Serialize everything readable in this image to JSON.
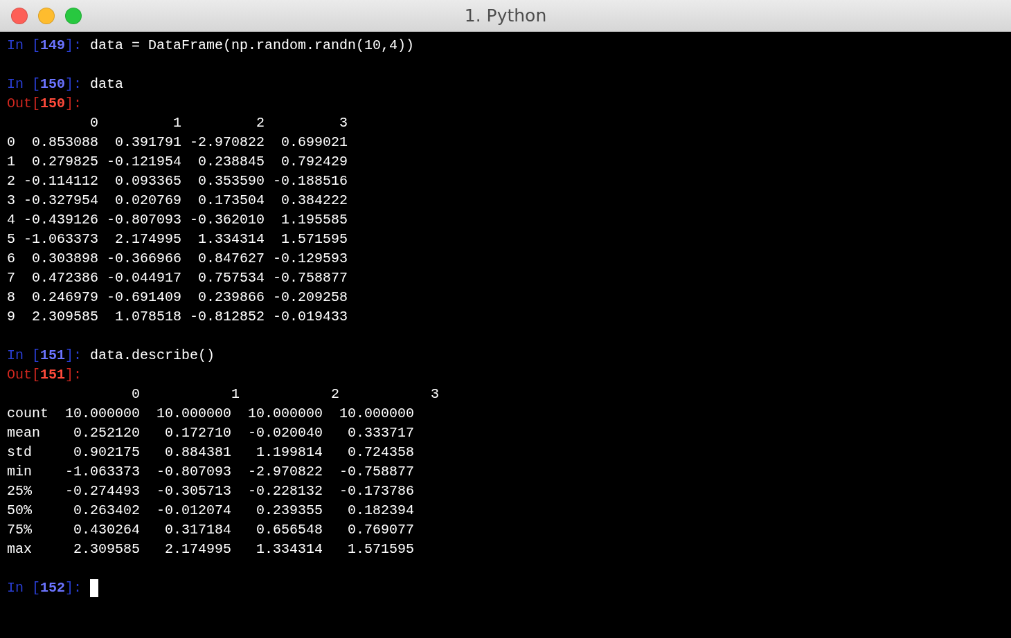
{
  "window": {
    "title": "1. Python"
  },
  "lines": [
    {
      "kind": "input",
      "prompt_open": "In [",
      "number": "149",
      "prompt_close": "]: ",
      "code": "data = DataFrame(np.random.randn(10,4))",
      "cursor": false
    },
    {
      "kind": "blank"
    },
    {
      "kind": "input",
      "prompt_open": "In [",
      "number": "150",
      "prompt_close": "]: ",
      "code": "data",
      "cursor": false
    },
    {
      "kind": "output",
      "prompt_open": "Out[",
      "number": "150",
      "prompt_close": "]:"
    },
    {
      "kind": "text",
      "text": "          0         1         2         3"
    },
    {
      "kind": "text",
      "text": "0  0.853088  0.391791 -2.970822  0.699021"
    },
    {
      "kind": "text",
      "text": "1  0.279825 -0.121954  0.238845  0.792429"
    },
    {
      "kind": "text",
      "text": "2 -0.114112  0.093365  0.353590 -0.188516"
    },
    {
      "kind": "text",
      "text": "3 -0.327954  0.020769  0.173504  0.384222"
    },
    {
      "kind": "text",
      "text": "4 -0.439126 -0.807093 -0.362010  1.195585"
    },
    {
      "kind": "text",
      "text": "5 -1.063373  2.174995  1.334314  1.571595"
    },
    {
      "kind": "text",
      "text": "6  0.303898 -0.366966  0.847627 -0.129593"
    },
    {
      "kind": "text",
      "text": "7  0.472386 -0.044917  0.757534 -0.758877"
    },
    {
      "kind": "text",
      "text": "8  0.246979 -0.691409  0.239866 -0.209258"
    },
    {
      "kind": "text",
      "text": "9  2.309585  1.078518 -0.812852 -0.019433"
    },
    {
      "kind": "blank"
    },
    {
      "kind": "input",
      "prompt_open": "In [",
      "number": "151",
      "prompt_close": "]: ",
      "code": "data.describe()",
      "cursor": false
    },
    {
      "kind": "output",
      "prompt_open": "Out[",
      "number": "151",
      "prompt_close": "]:"
    },
    {
      "kind": "text",
      "text": "               0           1           2           3"
    },
    {
      "kind": "text",
      "text": "count  10.000000  10.000000  10.000000  10.000000"
    },
    {
      "kind": "text",
      "text": "mean    0.252120   0.172710  -0.020040   0.333717"
    },
    {
      "kind": "text",
      "text": "std     0.902175   0.884381   1.199814   0.724358"
    },
    {
      "kind": "text",
      "text": "min    -1.063373  -0.807093  -2.970822  -0.758877"
    },
    {
      "kind": "text",
      "text": "25%    -0.274493  -0.305713  -0.228132  -0.173786"
    },
    {
      "kind": "text",
      "text": "50%     0.263402  -0.012074   0.239355   0.182394"
    },
    {
      "kind": "text",
      "text": "75%     0.430264   0.317184   0.656548   0.769077"
    },
    {
      "kind": "text",
      "text": "max     2.309585   2.174995   1.334314   1.571595"
    },
    {
      "kind": "blank"
    },
    {
      "kind": "input",
      "prompt_open": "In [",
      "number": "152",
      "prompt_close": "]: ",
      "cursor": true
    }
  ]
}
